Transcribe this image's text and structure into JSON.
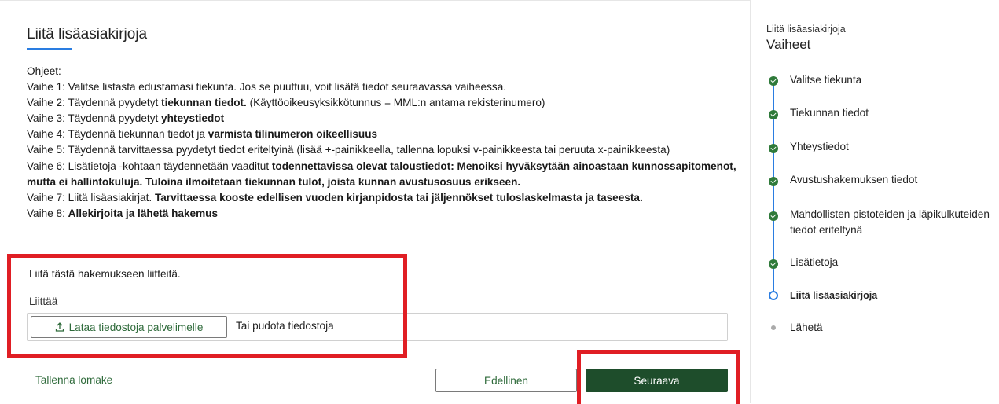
{
  "main": {
    "title": "Liitä lisäasiakirjoja",
    "instructions": {
      "heading": "Ohjeet:",
      "step1": "Vaihe 1: Valitse listasta edustamasi tiekunta. Jos se puuttuu, voit lisätä tiedot seuraavassa vaiheessa.",
      "step2_pre": "Vaihe 2: Täydennä pyydetyt ",
      "step2_bold": "tiekunnan tiedot.",
      "step2_post": " (Käyttöoikeusyksikkötunnus = MML:n antama rekisterinumero)",
      "step3_pre": "Vaihe 3: Täydennä pyydetyt ",
      "step3_bold": "yhteystiedot",
      "step4_pre": "Vaihe 4: Täydennä tiekunnan tiedot ja ",
      "step4_bold": "varmista tilinumeron oikeellisuus",
      "step5": "Vaihe 5: Täydennä tarvittaessa pyydetyt tiedot eriteltyinä (lisää +-painikkeella, tallenna lopuksi v-painikkeesta tai peruuta x-painikkeesta)",
      "step6_pre": "Vaihe 6: Lisätietoja -kohtaan täydennetään vaaditut ",
      "step6_bold": "todennettavissa olevat taloustiedot: Menoiksi hyväksytään ainoastaan kunnossapitomenot, mutta ei hallintokuluja. Tuloina ilmoitetaan tiekunnan tulot, joista kunnan avustusosuus erikseen.",
      "step7_pre": "Vaihe 7: Liitä lisäasiakirjat. ",
      "step7_bold": "Tarvittaessa kooste edellisen vuoden kirjanpidosta tai jäljennökset tuloslaskelmasta ja taseesta.",
      "step8_pre": "Vaihe 8: ",
      "step8_bold": "Allekirjoita ja lähetä hakemus"
    },
    "attach_intro": "Liitä tästä hakemukseen liitteitä.",
    "attach_label": "Liittää",
    "upload_button": "Lataa tiedostoja palvelimelle",
    "drop_text": "Tai pudota tiedostoja",
    "save_link": "Tallenna lomake",
    "prev_button": "Edellinen",
    "next_button": "Seuraava"
  },
  "sidebar": {
    "subtitle": "Liitä lisäasiakirjoja",
    "title": "Vaiheet",
    "steps": [
      {
        "label": "Valitse tiekunta",
        "status": "done"
      },
      {
        "label": "Tiekunnan tiedot",
        "status": "done"
      },
      {
        "label": "Yhteystiedot",
        "status": "done"
      },
      {
        "label": "Avustushakemuksen tiedot",
        "status": "done"
      },
      {
        "label": "Mahdollisten pistoteiden ja läpikulkuteiden tiedot eriteltynä",
        "status": "done"
      },
      {
        "label": "Lisätietoja",
        "status": "done"
      },
      {
        "label": "Liitä lisäasiakirjoja",
        "status": "current"
      },
      {
        "label": "Lähetä",
        "status": "pending"
      }
    ]
  },
  "colors": {
    "accent_green": "#1e4d2b",
    "link_green": "#2e6a3a",
    "step_blue": "#2a7de1",
    "highlight_red": "#e01e24"
  }
}
